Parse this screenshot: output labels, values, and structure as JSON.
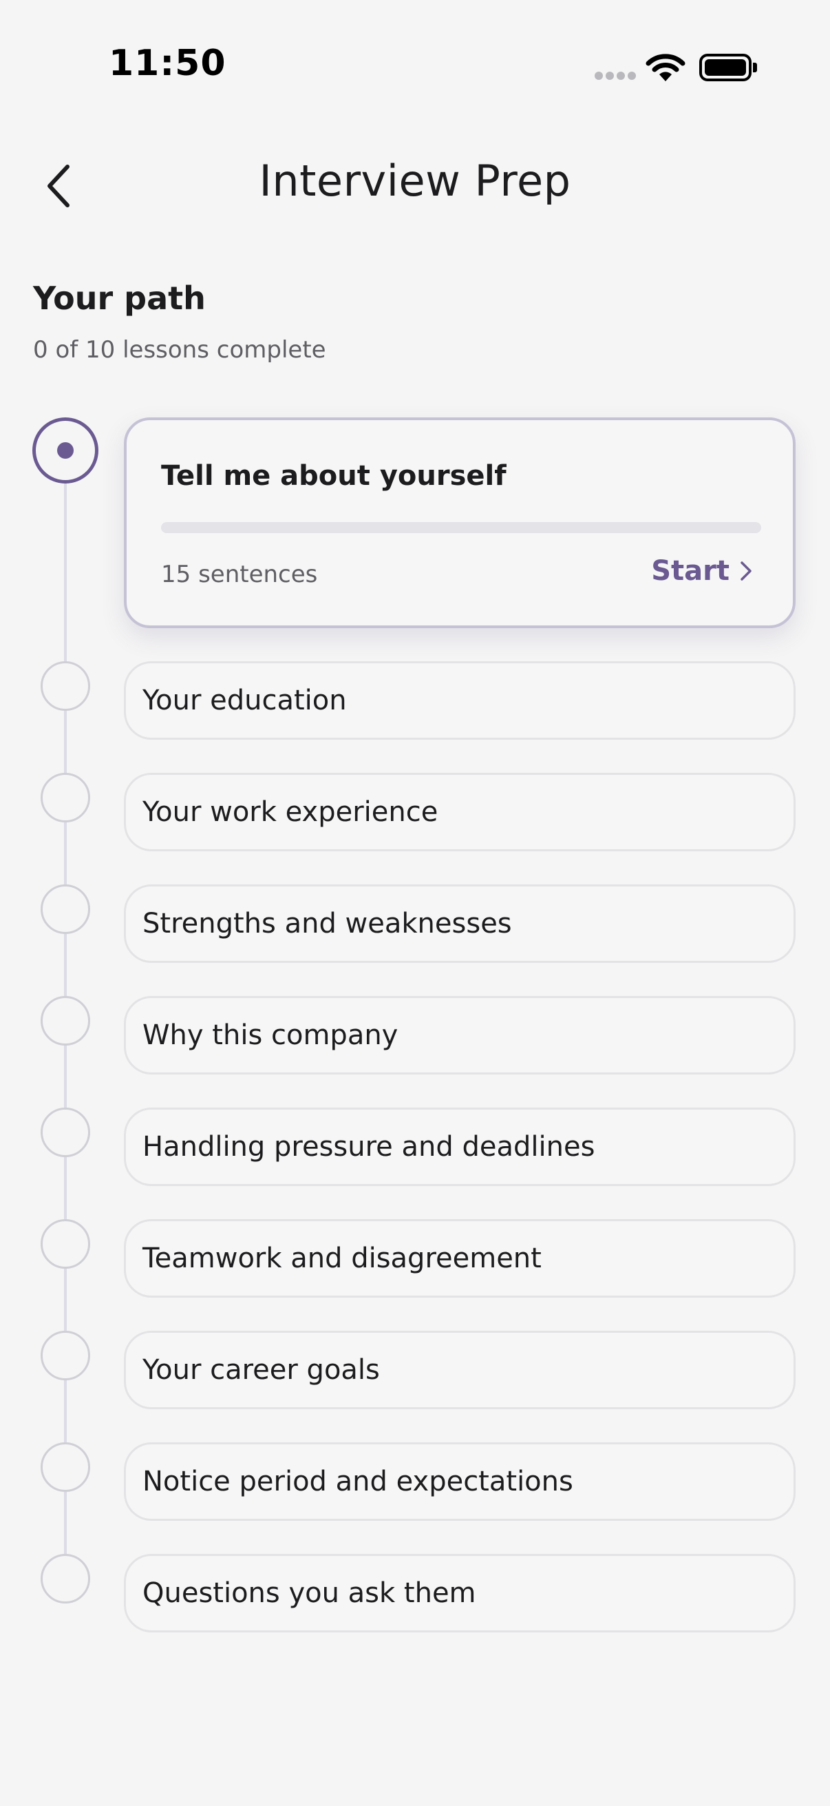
{
  "status_bar": {
    "time": "11:50"
  },
  "header": {
    "title": "Interview Prep"
  },
  "path": {
    "title": "Your path",
    "progress_text": "0 of 10 lessons complete"
  },
  "current_lesson": {
    "title": "Tell me about yourself",
    "meta": "15 sentences",
    "action_label": "Start",
    "progress": 0
  },
  "lessons": [
    {
      "label": "Your education"
    },
    {
      "label": "Your work experience"
    },
    {
      "label": "Strengths and weaknesses"
    },
    {
      "label": "Why this company"
    },
    {
      "label": "Handling pressure and deadlines"
    },
    {
      "label": "Teamwork and disagreement"
    },
    {
      "label": "Your career goals"
    },
    {
      "label": "Notice period and expectations"
    },
    {
      "label": "Questions you ask them"
    }
  ],
  "icons": {
    "back": "chevron-left-icon",
    "start": "chevron-right-icon",
    "signal": "cellular-signal-icon",
    "wifi": "wifi-icon",
    "battery": "battery-icon"
  },
  "colors": {
    "accent": "#6a5a91",
    "background": "#f5f5f5",
    "card_border": "#c5c2d6",
    "row_border": "#e3e3e6",
    "timeline": "#dcdbe6"
  }
}
